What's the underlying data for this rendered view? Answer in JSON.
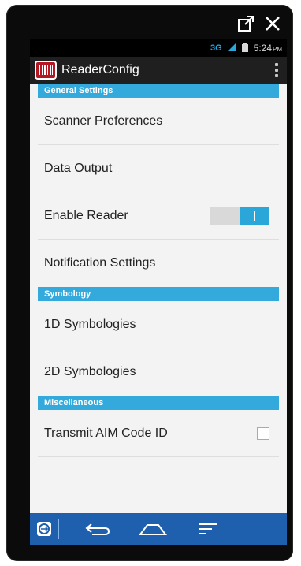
{
  "window": {
    "popout_icon": "popout-icon",
    "close_icon": "close-icon"
  },
  "status_bar": {
    "network": "3G",
    "time": "5:24",
    "ampm": "PM"
  },
  "action_bar": {
    "title": "ReaderConfig",
    "app_icon": "barcode-icon",
    "overflow_icon": "overflow-menu-icon"
  },
  "sections": [
    {
      "header": "General Settings",
      "items": [
        {
          "label": "Scanner Preferences"
        },
        {
          "label": "Data Output"
        },
        {
          "label": "Enable Reader",
          "control": "toggle",
          "value": true
        },
        {
          "label": "Notification Settings"
        }
      ]
    },
    {
      "header": "Symbology",
      "items": [
        {
          "label": "1D Symbologies"
        },
        {
          "label": "2D Symbologies"
        }
      ]
    },
    {
      "header": "Miscellaneous",
      "items": [
        {
          "label": "Transmit AIM Code ID",
          "control": "checkbox",
          "value": false
        }
      ]
    }
  ],
  "nav_bar": {
    "home_icon": "home-app-icon",
    "back_icon": "back-icon",
    "home_button_icon": "home-icon",
    "menu_icon": "menu-icon"
  },
  "colors": {
    "accent": "#33aadb",
    "toggle_on": "#2aa6d9",
    "nav_bar": "#1e5fae",
    "app_icon_red": "#b31824"
  }
}
